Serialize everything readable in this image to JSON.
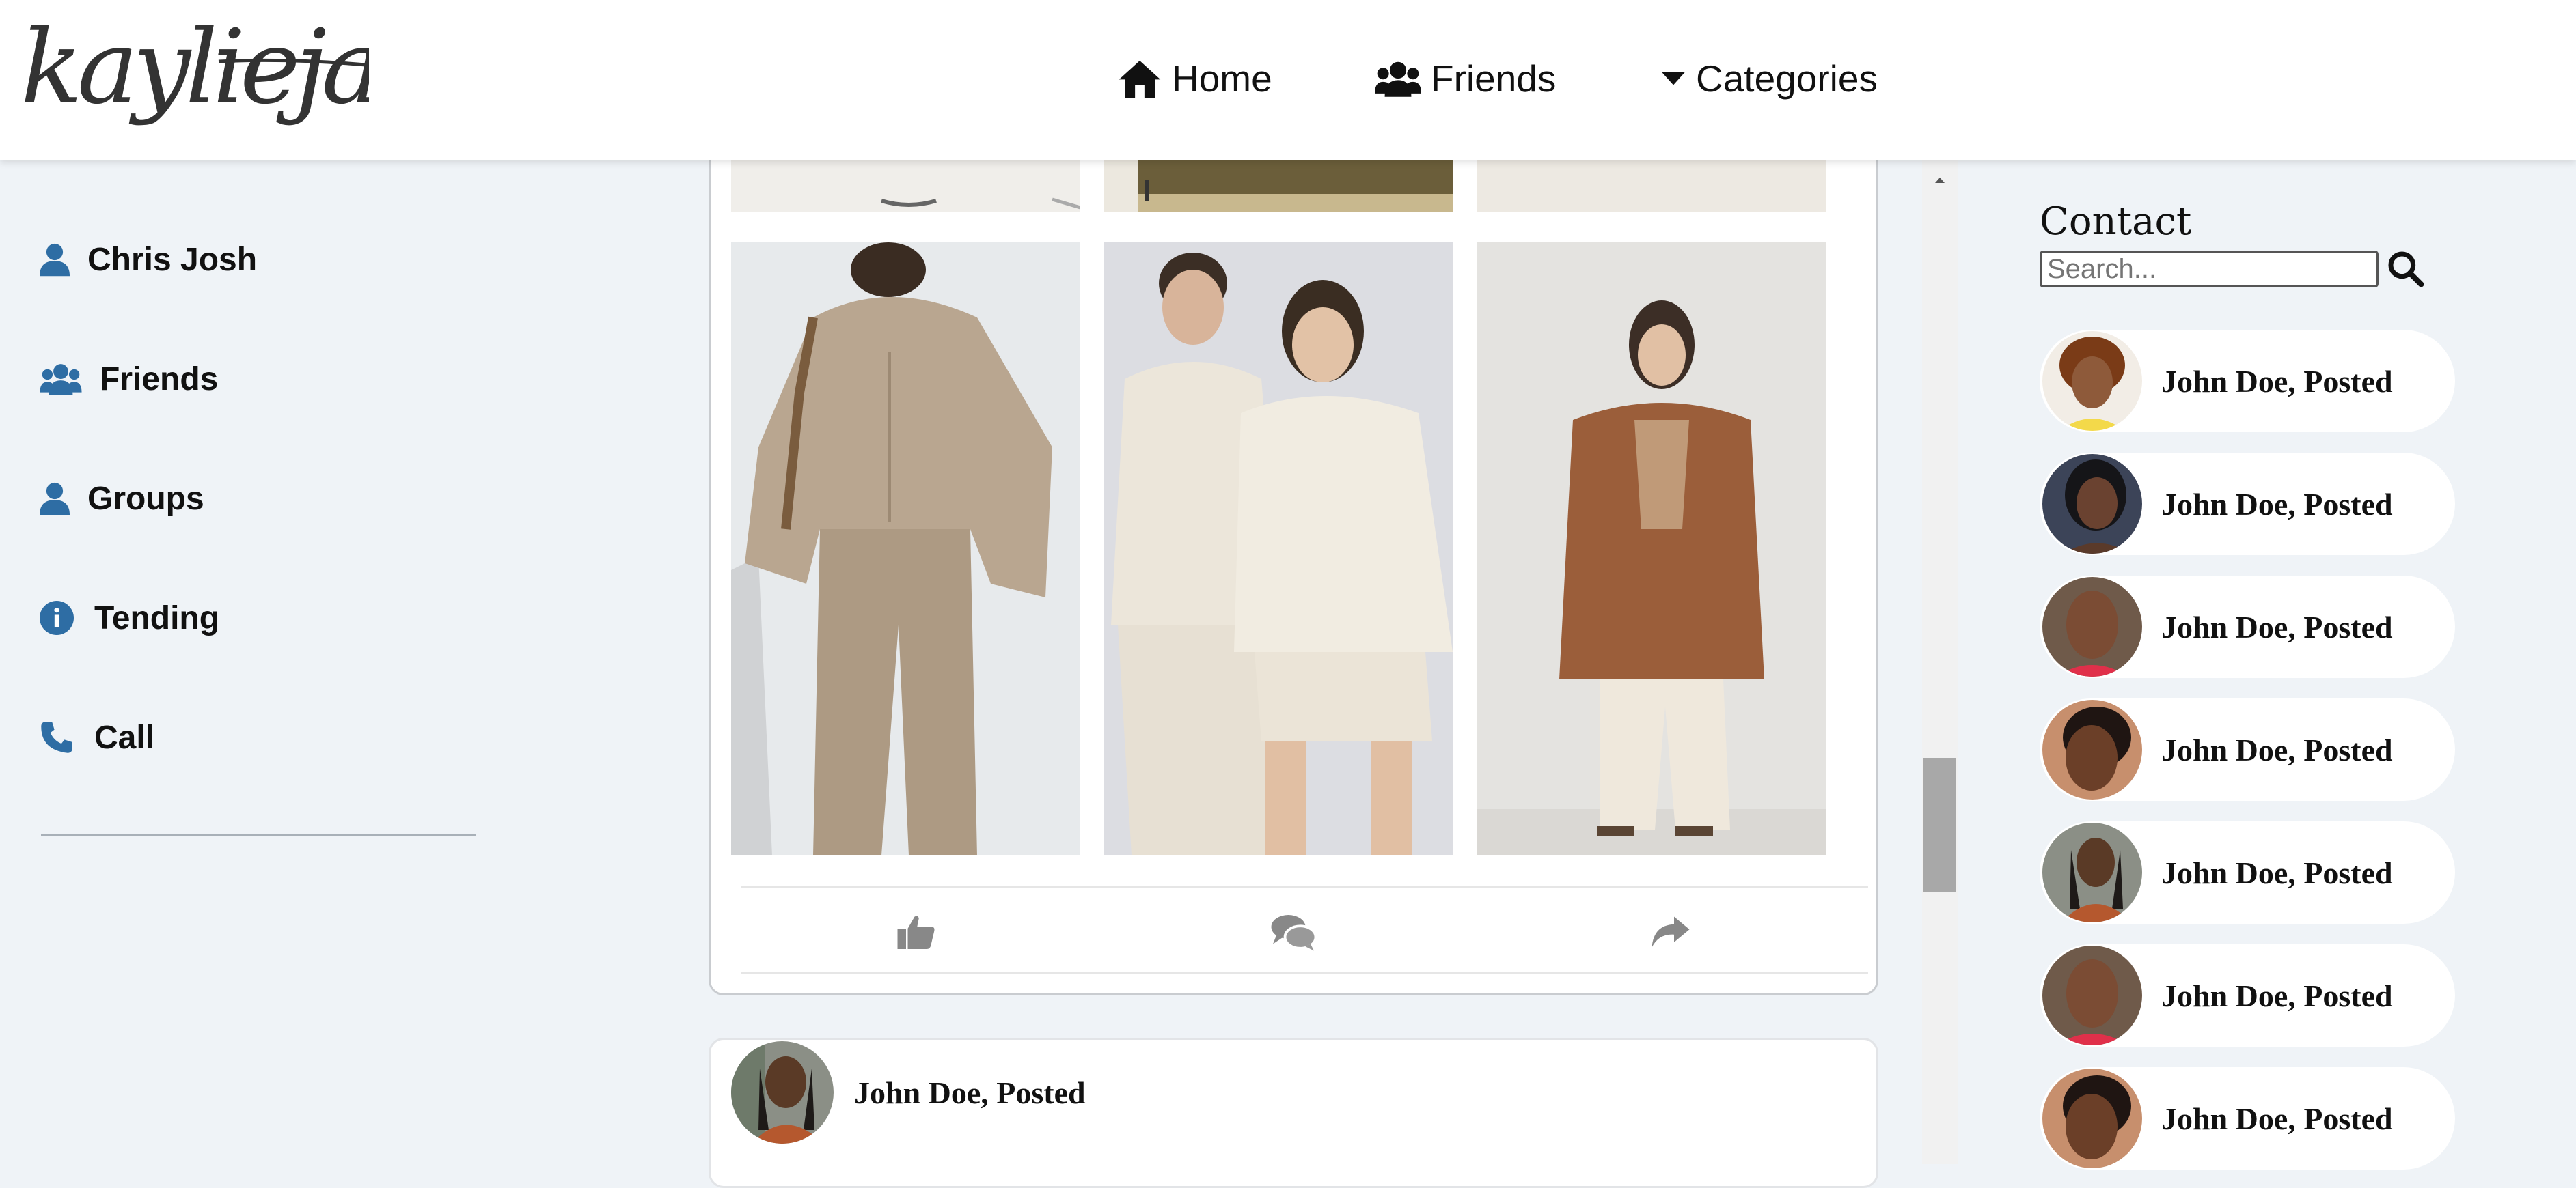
{
  "header": {
    "logo_text": "kayliejay",
    "nav": [
      {
        "label": "Home",
        "icon": "home-icon"
      },
      {
        "label": "Friends",
        "icon": "users-icon"
      },
      {
        "label": "Categories",
        "icon": "caret-down-icon"
      }
    ]
  },
  "sidebar": {
    "items": [
      {
        "label": "Chris Josh",
        "icon": "user-icon"
      },
      {
        "label": "Friends",
        "icon": "users-icon"
      },
      {
        "label": "Groups",
        "icon": "user-icon"
      },
      {
        "label": "Tending",
        "icon": "info-icon"
      },
      {
        "label": "Call",
        "icon": "phone-icon"
      }
    ]
  },
  "feed": {
    "actions": [
      {
        "icon": "thumbs-up-icon"
      },
      {
        "icon": "comments-icon"
      },
      {
        "icon": "share-icon"
      }
    ],
    "next_post": {
      "author": "John Doe, Posted"
    }
  },
  "contacts": {
    "title": "Contact",
    "search_placeholder": "Search...",
    "list": [
      {
        "name": "John Doe, Posted"
      },
      {
        "name": "John Doe, Posted"
      },
      {
        "name": "John Doe, Posted"
      },
      {
        "name": "John Doe, Posted"
      },
      {
        "name": "John Doe, Posted"
      },
      {
        "name": "John Doe, Posted"
      },
      {
        "name": "John Doe, Posted"
      }
    ]
  },
  "colors": {
    "accent_blue": "#2e6da4",
    "page_bg": "#eff3f7",
    "icon_gray": "#888888"
  }
}
